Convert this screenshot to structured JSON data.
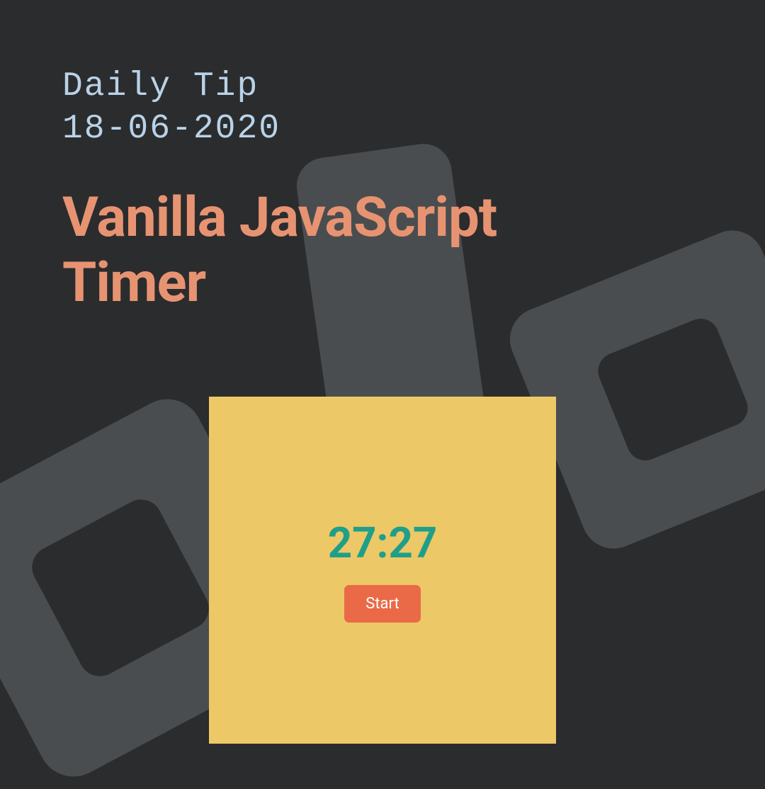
{
  "header": {
    "tip_label": "Daily Tip",
    "date": "18-06-2020"
  },
  "title": {
    "line1": "Vanilla JavaScript",
    "line2": "Timer"
  },
  "timer": {
    "display": "27:27",
    "button_label": "Start"
  },
  "colors": {
    "background": "#2b2c2d",
    "accent_shape": "#4a4d4f",
    "tip_text": "#b9d2e8",
    "title_text": "#e79372",
    "card_bg": "#edc866",
    "timer_text": "#1f9f8a",
    "button_bg": "#ea6a47",
    "button_text": "#ffffff"
  }
}
